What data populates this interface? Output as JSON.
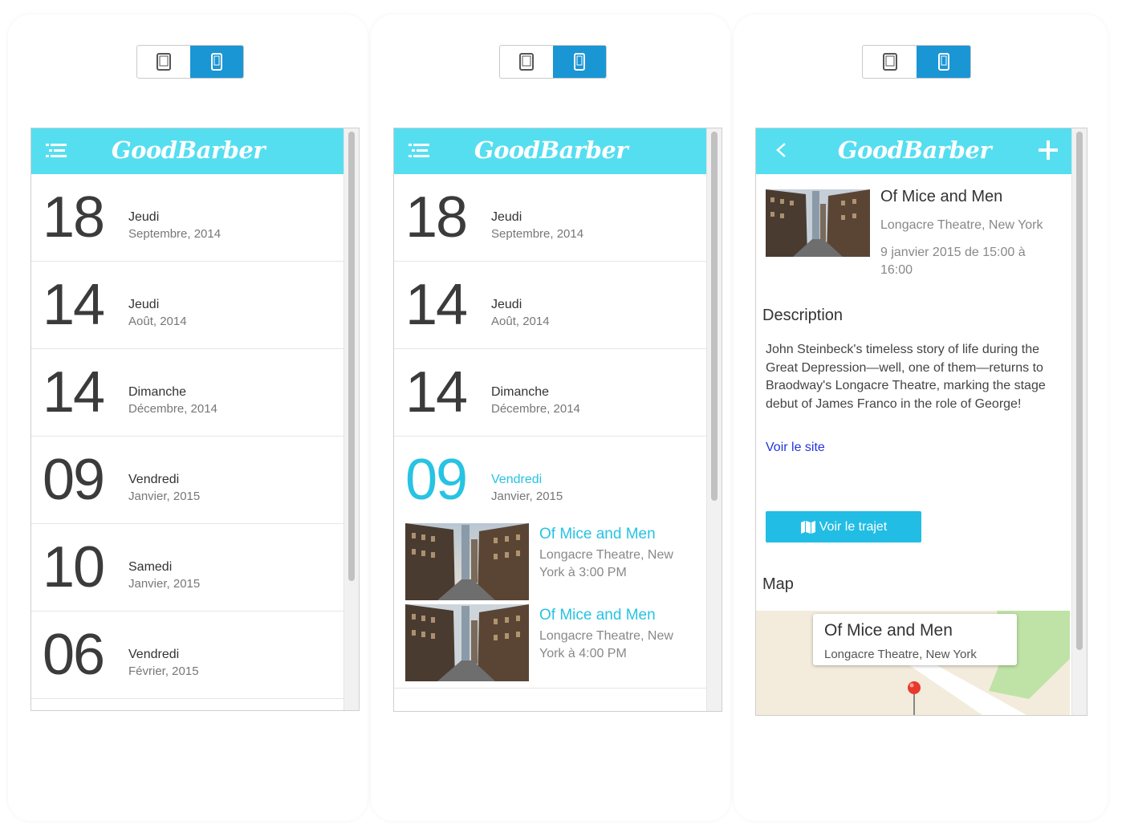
{
  "brand": {
    "logo": "GoodBarber",
    "topbar_color": "#55def0",
    "accent": "#27c3e2",
    "button_color": "#22bde5"
  },
  "screens": [
    {
      "days": [
        {
          "num": "18",
          "name": "Jeudi",
          "month": "Septembre, 2014"
        },
        {
          "num": "14",
          "name": "Jeudi",
          "month": "Août, 2014"
        },
        {
          "num": "14",
          "name": "Dimanche",
          "month": "Décembre, 2014"
        },
        {
          "num": "09",
          "name": "Vendredi",
          "month": "Janvier, 2015"
        },
        {
          "num": "10",
          "name": "Samedi",
          "month": "Janvier, 2015"
        },
        {
          "num": "06",
          "name": "Vendredi",
          "month": "Février, 2015"
        }
      ]
    },
    {
      "days": [
        {
          "num": "18",
          "name": "Jeudi",
          "month": "Septembre, 2014"
        },
        {
          "num": "14",
          "name": "Jeudi",
          "month": "Août, 2014"
        },
        {
          "num": "14",
          "name": "Dimanche",
          "month": "Décembre, 2014"
        },
        {
          "num": "09",
          "name": "Vendredi",
          "month": "Janvier, 2015"
        }
      ],
      "events": [
        {
          "title": "Of Mice and Men",
          "subtitle": "Longacre Theatre, New York à 3:00 PM"
        },
        {
          "title": "Of Mice and Men",
          "subtitle": "Longacre Theatre, New York à 4:00 PM"
        }
      ]
    },
    {
      "detail": {
        "title": "Of Mice and Men",
        "venue": "Longacre Theatre, New York",
        "datetime": "9 janvier 2015 de 15:00 à 16:00",
        "description_heading": "Description",
        "description": "John Steinbeck's timeless story of life during the Great Depression—well, one of them—returns to Braodway's Longacre Theatre, marking the stage debut of James Franco in the role of George!",
        "site_link": "Voir le site",
        "route_button": "Voir le trajet",
        "map_heading": "Map",
        "map_popup_title": "Of Mice and Men",
        "map_popup_sub": "Longacre Theatre, New York"
      }
    }
  ]
}
